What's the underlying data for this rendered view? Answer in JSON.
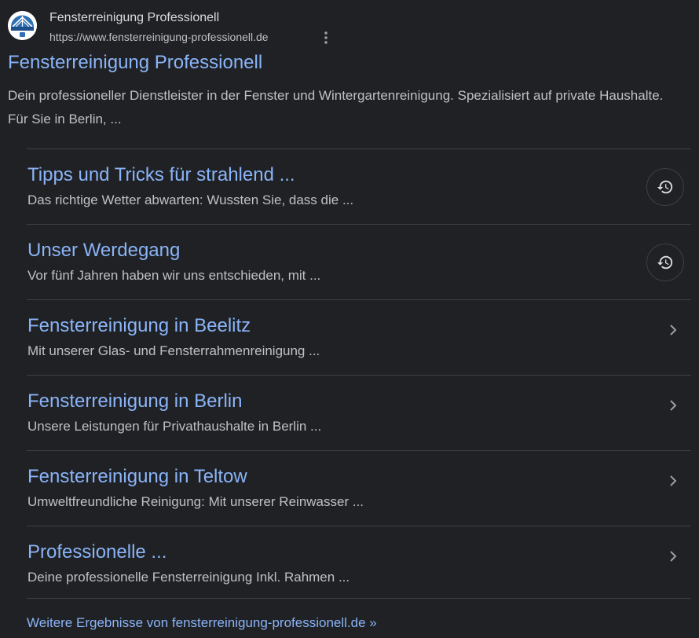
{
  "site": {
    "name": "Fensterreinigung Professionell",
    "url": "https://www.fensterreinigung-professionell.de",
    "favicon_icon": "company-logo"
  },
  "result": {
    "title": "Fensterreinigung Professionell",
    "snippet": "Dein professioneller Dienstleister in der Fenster und Wintergartenreinigung. Spezialisiert auf private Haushalte. Für Sie in Berlin, ..."
  },
  "sitelinks": [
    {
      "title": "Tipps und Tricks für strahlend ...",
      "desc": "Das richtige Wetter abwarten: Wussten Sie, dass die ...",
      "icon": "history-icon"
    },
    {
      "title": "Unser Werdegang",
      "desc": "Vor fünf Jahren haben wir uns entschieden, mit ...",
      "icon": "history-icon"
    },
    {
      "title": "Fensterreinigung in Beelitz",
      "desc": "Mit unserer Glas- und Fensterrahmenreinigung ...",
      "icon": "chevron-right-icon"
    },
    {
      "title": "Fensterreinigung in Berlin",
      "desc": "Unsere Leistungen für Privathaushalte in Berlin ...",
      "icon": "chevron-right-icon"
    },
    {
      "title": "Fensterreinigung in Teltow",
      "desc": "Umweltfreundliche Reinigung: Mit unserer Reinwasser ...",
      "icon": "chevron-right-icon"
    },
    {
      "title": "Professionelle ...",
      "desc": "Deine professionelle Fensterreinigung Inkl. Rahmen ...",
      "icon": "chevron-right-icon"
    }
  ],
  "more_results": "Weitere Ergebnisse von fensterreinigung-professionell.de »",
  "colors": {
    "background": "#202124",
    "link": "#8ab4f8",
    "text": "#bdc1c6",
    "divider": "#3c4043"
  }
}
